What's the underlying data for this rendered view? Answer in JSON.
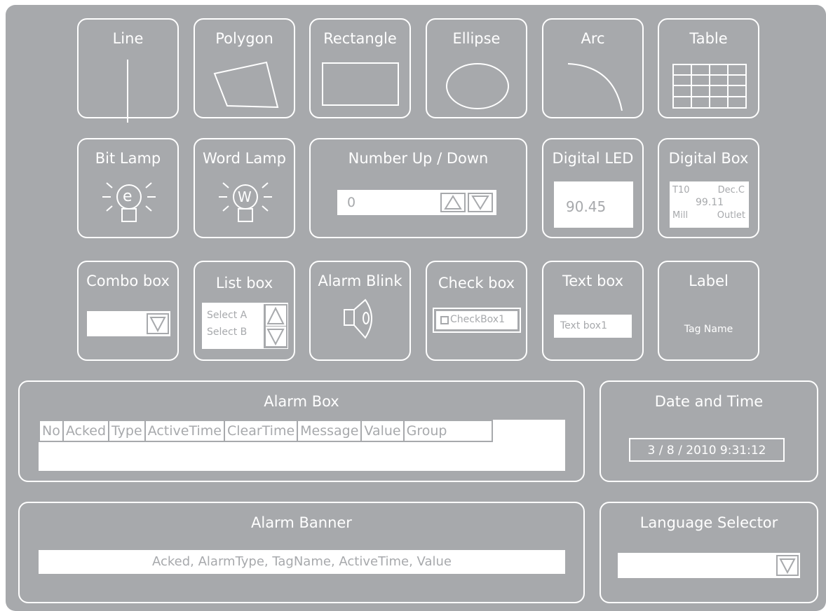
{
  "shapes": {
    "line": "Line",
    "polygon": "Polygon",
    "rectangle": "Rectangle",
    "ellipse": "Ellipse",
    "arc": "Arc",
    "table": "Table"
  },
  "bit_lamp": {
    "title": "Bit Lamp",
    "glyph": "e"
  },
  "word_lamp": {
    "title": "Word Lamp",
    "glyph": "W"
  },
  "number_updown": {
    "title": "Number Up / Down",
    "value": "0"
  },
  "digital_led": {
    "title": "Digital LED",
    "value": "90.45"
  },
  "digital_box": {
    "title": "Digital Box",
    "top_left": "T10",
    "top_right": "Dec.C",
    "value": "99.11",
    "bottom_left": "Mill",
    "bottom_right": "Outlet"
  },
  "combo_box": {
    "title": "Combo box"
  },
  "list_box": {
    "title": "List box",
    "items": [
      "Select A",
      "Select B"
    ]
  },
  "alarm_blink": {
    "title": "Alarm Blink"
  },
  "check_box": {
    "title": "Check box",
    "label": "CheckBox1"
  },
  "text_box": {
    "title": "Text box",
    "value": "Text box1"
  },
  "label": {
    "title": "Label",
    "value": "Tag Name"
  },
  "alarm_box": {
    "title": "Alarm Box",
    "columns": [
      "No",
      "Acked",
      "Type",
      "ActiveTime",
      "ClearTime",
      "Message",
      "Value",
      "Group"
    ]
  },
  "date_time": {
    "title": "Date and Time",
    "value": "3 / 8 / 2010 9:31:12"
  },
  "alarm_banner": {
    "title": "Alarm Banner",
    "value": "Acked, AlarmType, TagName, ActiveTime, Value"
  },
  "language_selector": {
    "title": "Language Selector"
  },
  "icons": [
    "line-icon",
    "polygon-icon",
    "rectangle-icon",
    "ellipse-icon",
    "arc-icon",
    "table-icon",
    "lamp-icon",
    "up-arrow-icon",
    "down-arrow-icon",
    "speaker-icon",
    "checkbox-icon"
  ],
  "colors": {
    "panel": "#a7a9ac",
    "foreground": "#ffffff"
  }
}
